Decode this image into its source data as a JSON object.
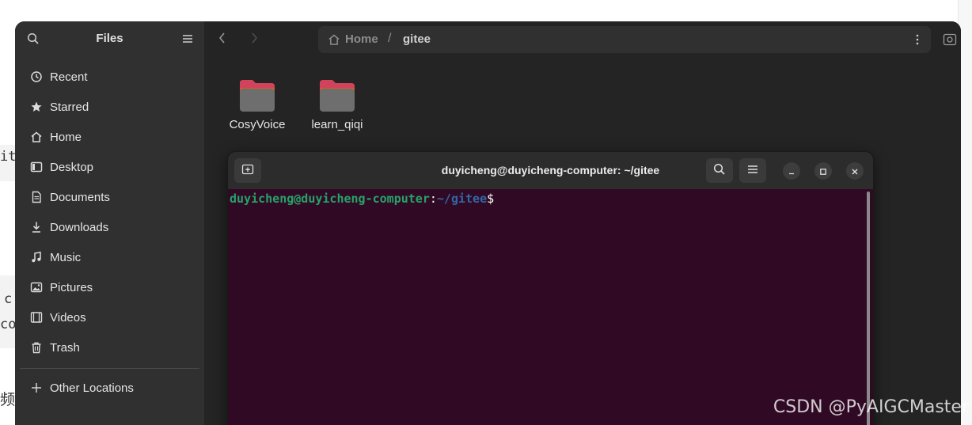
{
  "background": {
    "snippets": [
      "it",
      "c",
      "co",
      "频"
    ]
  },
  "files": {
    "sidebar": {
      "title": "Files",
      "items": [
        {
          "label": "Recent",
          "icon": "clock-icon"
        },
        {
          "label": "Starred",
          "icon": "star-icon"
        },
        {
          "label": "Home",
          "icon": "home-icon"
        },
        {
          "label": "Desktop",
          "icon": "desktop-icon"
        },
        {
          "label": "Documents",
          "icon": "document-icon"
        },
        {
          "label": "Downloads",
          "icon": "download-icon"
        },
        {
          "label": "Music",
          "icon": "music-icon"
        },
        {
          "label": "Pictures",
          "icon": "picture-icon"
        },
        {
          "label": "Videos",
          "icon": "video-icon"
        },
        {
          "label": "Trash",
          "icon": "trash-icon"
        }
      ],
      "other_locations": "Other Locations"
    },
    "path": {
      "home": "Home",
      "separator": "/",
      "current": "gitee"
    },
    "folders": [
      {
        "name": "CosyVoice"
      },
      {
        "name": "learn_qiqi"
      }
    ]
  },
  "terminal": {
    "title": "duyicheng@duyicheng-computer: ~/gitee",
    "prompt": {
      "user_host": "duyicheng@duyicheng-computer",
      "colon": ":",
      "path": "~/gitee",
      "dollar": "$"
    }
  },
  "watermark": "CSDN @PyAIGCMaster",
  "colors": {
    "terminal_bg": "#300a24",
    "prompt_user": "#26a269",
    "prompt_path": "#3465a4",
    "sidebar_bg": "#303030",
    "content_bg": "#242424"
  }
}
